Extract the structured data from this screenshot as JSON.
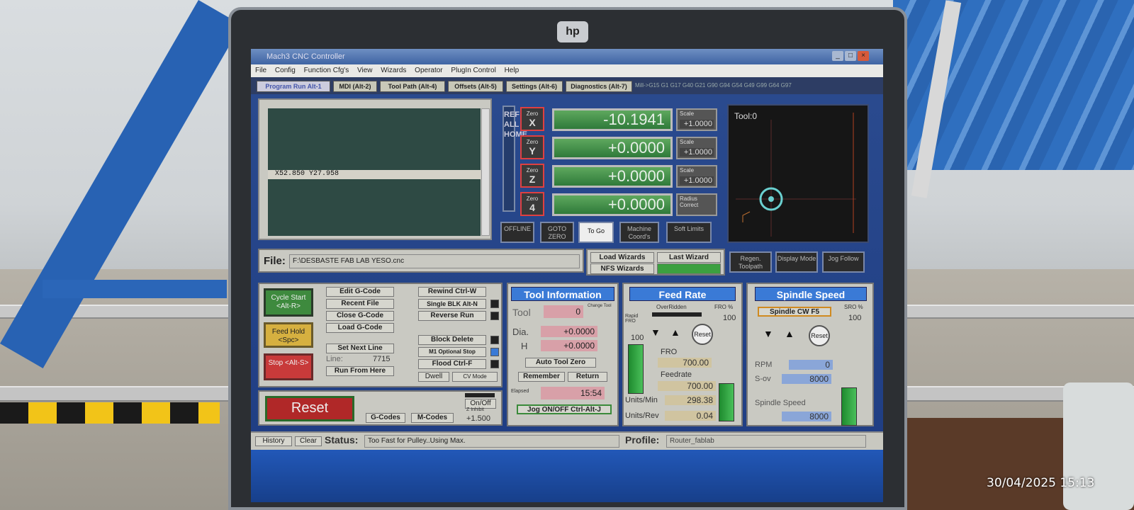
{
  "window": {
    "title": "Mach3 CNC Controller"
  },
  "menu": [
    "File",
    "Config",
    "Function Cfg's",
    "View",
    "Wizards",
    "Operator",
    "PlugIn Control",
    "Help"
  ],
  "tabs": [
    "Program Run Alt-1",
    "MDI (Alt-2)",
    "Tool Path (Alt-4)",
    "Offsets (Alt-5)",
    "Settings (Alt-6)",
    "Diagnostics (Alt-7)"
  ],
  "tab_info": "Mill->G15  G1 G17 G40 G21 G90 G94 G54 G49 G99 G64 G97",
  "gcode_lines": [
    "X52.850  Y27.958"
  ],
  "ref_all_home": "REF ALL HOME",
  "axes": [
    {
      "zero_label": "Zero",
      "axis": "X",
      "value": "-10.1941",
      "scale_label": "Scale",
      "scale": "+1.0000"
    },
    {
      "zero_label": "Zero",
      "axis": "Y",
      "value": "+0.0000",
      "scale_label": "Scale",
      "scale": "+1.0000"
    },
    {
      "zero_label": "Zero",
      "axis": "Z",
      "value": "+0.0000",
      "scale_label": "Scale",
      "scale": "+1.0000"
    },
    {
      "zero_label": "Zero",
      "axis": "4",
      "value": "+0.0000",
      "scale_label": "Radius Correct",
      "scale": ""
    }
  ],
  "dro_buttons": [
    "OFFLINE",
    "GOTO ZERO",
    "To Go",
    "Machine Coord's",
    "Soft Limits"
  ],
  "toolpath": {
    "label": "Tool:0"
  },
  "file": {
    "label": "File:",
    "path": "F:\\DESBASTE FAB LAB YESO.cnc"
  },
  "wizards": [
    "Load Wizards",
    "Last Wizard",
    "NFS Wizards"
  ],
  "view_buttons": [
    "Regen. Toolpath",
    "Display Mode",
    "Jog Follow"
  ],
  "controls": {
    "cycle_start": "Cycle Start <Alt-R>",
    "feed_hold": "Feed Hold <Spc>",
    "stop": "Stop <Alt-S>",
    "edit": "Edit G-Code",
    "recent": "Recent File",
    "close": "Close G-Code",
    "load": "Load G-Code",
    "set_next": "Set Next Line",
    "line_label": "Line:",
    "line_value": "7715",
    "run_from": "Run From Here",
    "rewind": "Rewind Ctrl-W",
    "single": "Single BLK Alt-N",
    "reverse": "Reverse Run",
    "block_delete": "Block Delete",
    "m1": "M1 Optional Stop",
    "flood": "Flood Ctrl-F",
    "dwell": "Dwell",
    "cv": "CV Mode"
  },
  "reset": {
    "label": "Reset",
    "onoff": "On/Off",
    "zinhibit": "Z Inhibit",
    "zvalue": "+1.500",
    "gcodes": "G-Codes",
    "mcodes": "M-Codes"
  },
  "tool_info": {
    "title": "Tool Information",
    "tool_label": "Tool",
    "tool": "0",
    "change": "Change Tool",
    "dia_label": "Dia.",
    "dia": "+0.0000",
    "h_label": "H",
    "h": "+0.0000",
    "auto_zero": "Auto Tool Zero",
    "remember": "Remember",
    "return": "Return",
    "elapsed_label": "Elapsed",
    "elapsed": "15:54",
    "jog": "Jog ON/OFF Ctrl-Alt-J"
  },
  "feed_rate": {
    "title": "Feed Rate",
    "overridden": "OverRidden",
    "fro_pct_label": "FRO %",
    "fro_pct": "100",
    "rapid_label": "Rapid FRO",
    "rapid": "100",
    "reset": "Reset",
    "fro_label": "FRO",
    "fro": "700.00",
    "feedrate_label": "Feedrate",
    "feedrate": "700.00",
    "units_min_label": "Units/Min",
    "units_min": "298.38",
    "units_rev_label": "Units/Rev",
    "units_rev": "0.04"
  },
  "spindle": {
    "title": "Spindle Speed",
    "cw": "Spindle CW F5",
    "sro_label": "SRO %",
    "sro": "100",
    "reset": "Reset",
    "rpm_label": "RPM",
    "rpm": "0",
    "sov_label": "S-ov",
    "sov": "8000",
    "speed_label": "Spindle Speed",
    "speed": "8000"
  },
  "status": {
    "history": "History",
    "clear": "Clear",
    "label": "Status:",
    "text": "Too Fast for Pulley..Using Max.",
    "profile_label": "Profile:",
    "profile": "Router_fablab"
  },
  "photo": {
    "timestamp": "30/04/2025  15:13",
    "laptop_brand": "hp"
  }
}
